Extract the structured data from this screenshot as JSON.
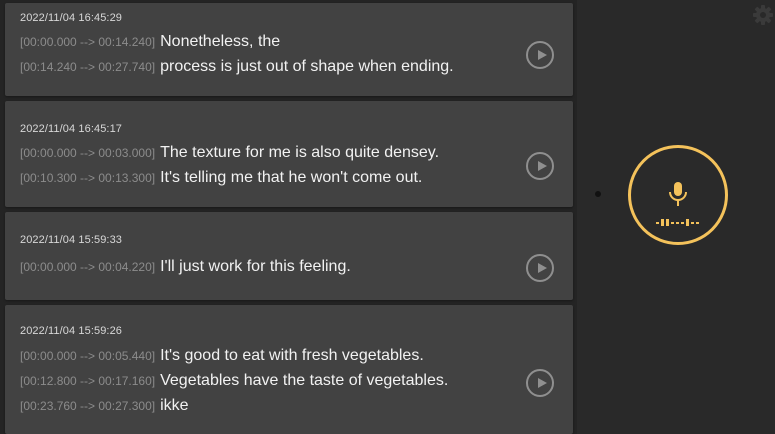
{
  "colors": {
    "accent": "#f4c25b",
    "card": "#424242",
    "background": "#292929"
  },
  "icons": {
    "play": "play-icon",
    "settings": "gear-icon",
    "record": "microphone-icon"
  },
  "entries": [
    {
      "timestamp": "2022/11/04 16:45:29",
      "lines": [
        {
          "range": "[00:00.000 --> 00:14.240]",
          "text": "Nonetheless, the"
        },
        {
          "range": "[00:14.240 --> 00:27.740]",
          "text": "process is just out of shape when ending."
        }
      ]
    },
    {
      "timestamp": "2022/11/04 16:45:17",
      "lines": [
        {
          "range": "[00:00.000 --> 00:03.000]",
          "text": "The texture for me is also quite densey."
        },
        {
          "range": "[00:10.300 --> 00:13.300]",
          "text": "It's telling me that he won't come out."
        }
      ]
    },
    {
      "timestamp": "2022/11/04 15:59:33",
      "lines": [
        {
          "range": "[00:00.000 --> 00:04.220]",
          "text": "I'll just work for this feeling."
        }
      ]
    },
    {
      "timestamp": "2022/11/04 15:59:26",
      "lines": [
        {
          "range": "[00:00.000 --> 00:05.440]",
          "text": "It's good to eat with fresh vegetables."
        },
        {
          "range": "[00:12.800 --> 00:17.160]",
          "text": "Vegetables have the taste of vegetables."
        },
        {
          "range": "[00:23.760 --> 00:27.300]",
          "text": "ikke"
        }
      ]
    }
  ]
}
